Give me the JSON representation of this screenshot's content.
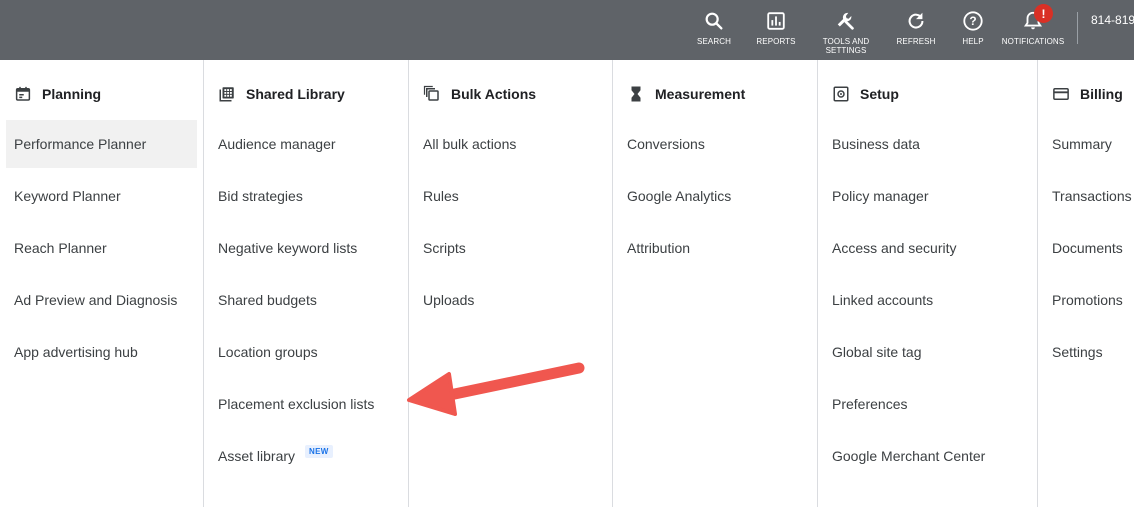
{
  "topbar": {
    "search": "SEARCH",
    "reports": "REPORTS",
    "tools_line1": "TOOLS AND",
    "tools_line2": "SETTINGS",
    "refresh": "REFRESH",
    "help": "HELP",
    "notifications": "NOTIFICATIONS",
    "notification_badge": "!",
    "account_id": "814-819"
  },
  "columns": [
    {
      "title": "Planning",
      "icon": "calendar-icon",
      "items": [
        "Performance Planner",
        "Keyword Planner",
        "Reach Planner",
        "Ad Preview and Diagnosis",
        "App advertising hub"
      ]
    },
    {
      "title": "Shared Library",
      "icon": "library-icon",
      "items": [
        "Audience manager",
        "Bid strategies",
        "Negative keyword lists",
        "Shared budgets",
        "Location groups",
        "Placement exclusion lists",
        "Asset library"
      ],
      "new_badge": "NEW"
    },
    {
      "title": "Bulk Actions",
      "icon": "copy-icon",
      "items": [
        "All bulk actions",
        "Rules",
        "Scripts",
        "Uploads"
      ]
    },
    {
      "title": "Measurement",
      "icon": "hourglass-icon",
      "items": [
        "Conversions",
        "Google Analytics",
        "Attribution"
      ]
    },
    {
      "title": "Setup",
      "icon": "setup-gear-icon",
      "items": [
        "Business data",
        "Policy manager",
        "Access and security",
        "Linked accounts",
        "Global site tag",
        "Preferences",
        "Google Merchant Center"
      ]
    },
    {
      "title": "Billing",
      "icon": "credit-card-icon",
      "items": [
        "Summary",
        "Transactions",
        "Documents",
        "Promotions",
        "Settings"
      ]
    }
  ],
  "colors": {
    "topbar_bg": "#5f6368",
    "arrow": "#f0574f",
    "active_item_bg": "#f1f1f1",
    "badge_red": "#d93025",
    "new_badge_blue": "#1a73e8"
  }
}
